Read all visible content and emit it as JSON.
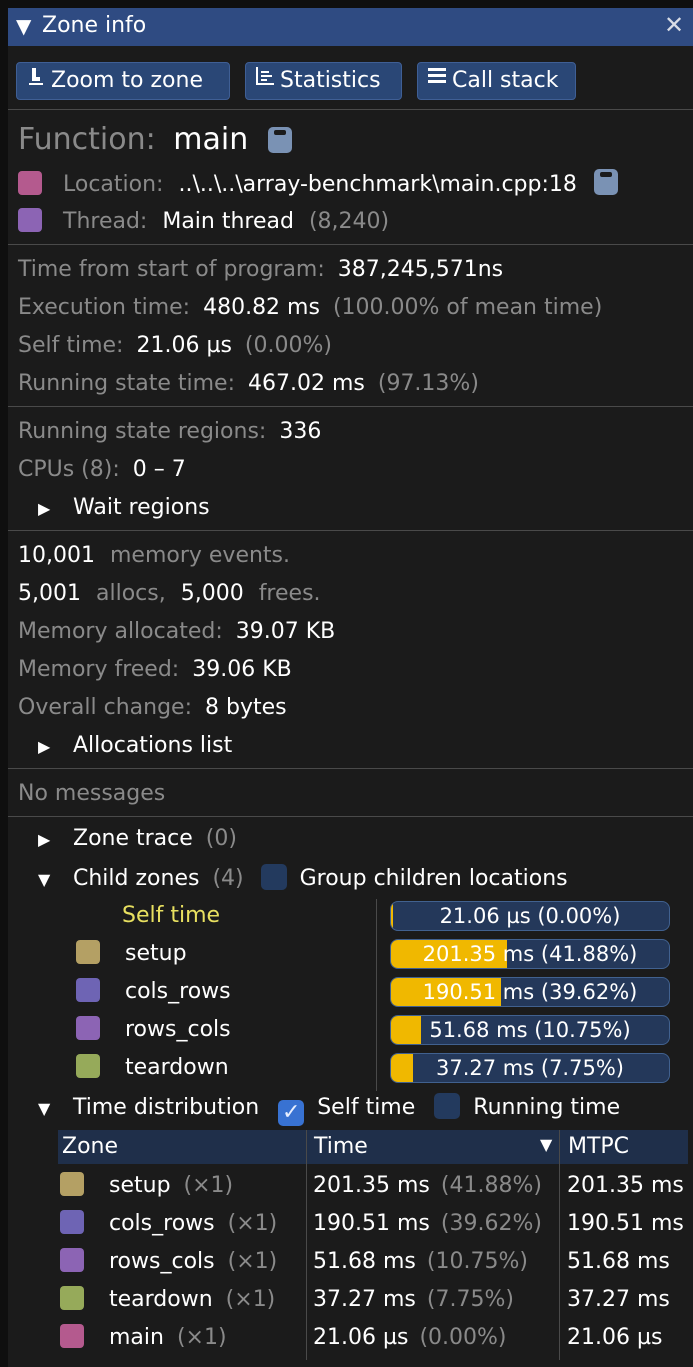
{
  "window": {
    "title": "Zone info",
    "close_glyph": "✕"
  },
  "toolbar": {
    "zoom_label": "Zoom to zone",
    "zoom_icon": "zoom-icon",
    "stats_label": "Statistics",
    "stats_icon": "statistics-icon",
    "callstack_label": "Call stack",
    "callstack_icon": "call-stack-icon"
  },
  "function": {
    "label": "Function:",
    "value": "main"
  },
  "location": {
    "label": "Location:",
    "value": "..\\..\\..\\array-benchmark\\main.cpp:18",
    "color": "#b45a8e"
  },
  "thread": {
    "label": "Thread:",
    "value": "Main thread",
    "id": "(8,240)",
    "color": "#8c64b4"
  },
  "timing": {
    "start_label": "Time from start of program:",
    "start_value": "387,245,571ns",
    "exec_label": "Execution time:",
    "exec_value": "480.82 ms",
    "exec_pct": "(100.00% of mean time)",
    "self_label": "Self time:",
    "self_value": "21.06 µs",
    "self_pct": "(0.00%)",
    "running_label": "Running state time:",
    "running_value": "467.02 ms",
    "running_pct": "(97.13%)"
  },
  "running": {
    "regions_label": "Running state regions:",
    "regions_value": "336",
    "cpus_label": "CPUs (8):",
    "cpus_value": "0 – 7",
    "wait_label": "Wait regions"
  },
  "memory": {
    "events_value": "10,001",
    "events_label": "memory events.",
    "allocs_value": "5,001",
    "allocs_label": "allocs,",
    "frees_value": "5,000",
    "frees_label": "frees.",
    "allocated_label": "Memory allocated:",
    "allocated_value": "39.07 KB",
    "freed_label": "Memory freed:",
    "freed_value": "39.06 KB",
    "change_label": "Overall change:",
    "change_value": "8 bytes",
    "alloc_list_label": "Allocations list"
  },
  "messages": {
    "label": "No messages"
  },
  "zone_trace": {
    "label": "Zone trace",
    "count": "(0)"
  },
  "child_zones": {
    "label": "Child zones",
    "count": "(4)",
    "group_label": "Group children locations",
    "group_checked": false,
    "self": {
      "name": "Self time",
      "text": "21.06 µs (0.00%)",
      "fraction": 0.0
    },
    "items": [
      {
        "name": "setup",
        "color": "#b4a064",
        "text": "201.35 ms (41.88%)",
        "fraction": 0.4188
      },
      {
        "name": "cols_rows",
        "color": "#6e64b4",
        "text": "190.51 ms (39.62%)",
        "fraction": 0.3962
      },
      {
        "name": "rows_cols",
        "color": "#8c64b4",
        "text": "51.68 ms (10.75%)",
        "fraction": 0.1075
      },
      {
        "name": "teardown",
        "color": "#96aa5a",
        "text": "37.27 ms (7.75%)",
        "fraction": 0.0775
      }
    ]
  },
  "time_distribution": {
    "label": "Time distribution",
    "self_time_label": "Self time",
    "self_time_checked": true,
    "running_time_label": "Running time",
    "running_time_checked": false,
    "headers": {
      "zone": "Zone",
      "time": "Time",
      "mtpc": "MTPC"
    },
    "rows": [
      {
        "name": "setup",
        "count": "(×1)",
        "time": "201.35 ms",
        "pct": "(41.88%)",
        "mtpc": "201.35 ms",
        "color": "#b4a064"
      },
      {
        "name": "cols_rows",
        "count": "(×1)",
        "time": "190.51 ms",
        "pct": "(39.62%)",
        "mtpc": "190.51 ms",
        "color": "#6e64b4"
      },
      {
        "name": "rows_cols",
        "count": "(×1)",
        "time": "51.68 ms",
        "pct": "(10.75%)",
        "mtpc": "51.68 ms",
        "color": "#8c64b4"
      },
      {
        "name": "teardown",
        "count": "(×1)",
        "time": "37.27 ms",
        "pct": "(7.75%)",
        "mtpc": "37.27 ms",
        "color": "#96aa5a"
      },
      {
        "name": "main",
        "count": "(×1)",
        "time": "21.06 µs",
        "pct": "(0.00%)",
        "mtpc": "21.06 µs",
        "color": "#b45a8e"
      }
    ]
  }
}
